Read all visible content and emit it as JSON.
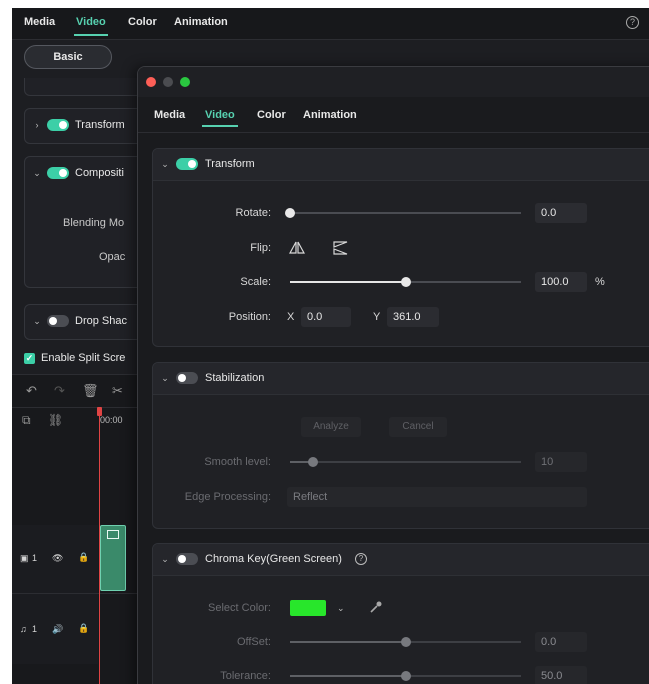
{
  "background": {
    "tabs": [
      "Media",
      "Video",
      "Color",
      "Animation"
    ],
    "active_tab": "Video",
    "help_glyph": "?",
    "basic_label": "Basic",
    "panels": {
      "transform_label": "Transform",
      "compositing_label": "Compositi",
      "blending_label": "Blending Mo",
      "opacity_label": "Opac",
      "drop_shadow_label": "Drop Shac"
    },
    "split_screen_label": "Enable Split Scre",
    "timeline": {
      "time_label": "00:00",
      "video_track_label": "1",
      "audio_track_label": "1"
    }
  },
  "inspector": {
    "tabs": [
      "Media",
      "Video",
      "Color",
      "Animation"
    ],
    "active_tab": "Video",
    "transform": {
      "title": "Transform",
      "enabled": true,
      "rotate_label": "Rotate:",
      "rotate_value": "0.0",
      "rotate_fraction": 0.0,
      "flip_label": "Flip:",
      "scale_label": "Scale:",
      "scale_value": "100.0",
      "scale_unit": "%",
      "scale_fraction": 0.5,
      "position_label": "Position:",
      "x_label": "X",
      "x_value": "0.0",
      "y_label": "Y",
      "y_value": "361.0"
    },
    "stabilization": {
      "title": "Stabilization",
      "enabled": false,
      "analyze_label": "Analyze",
      "cancel_label": "Cancel",
      "smooth_label": "Smooth level:",
      "smooth_value": "10",
      "smooth_fraction": 0.1,
      "edge_label": "Edge Processing:",
      "edge_value": "Reflect"
    },
    "chroma": {
      "title": "Chroma Key(Green Screen)",
      "enabled": false,
      "help_glyph": "?",
      "select_color_label": "Select Color:",
      "selected_color": "#28e62b",
      "offset_label": "OffSet:",
      "offset_value": "0.0",
      "offset_fraction": 0.5,
      "tolerance_label": "Tolerance:",
      "tolerance_value": "50.0",
      "tolerance_fraction": 0.5
    }
  },
  "colors": {
    "accent": "#3ccfa7",
    "playhead": "#e04444",
    "clip": "#3a8a6a"
  }
}
